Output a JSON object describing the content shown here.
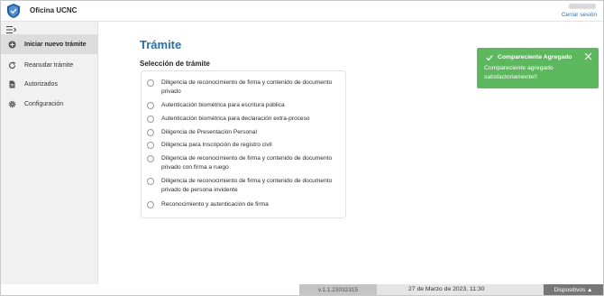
{
  "header": {
    "app_title": "Oficina UCNC",
    "logout_label": "Cerrar sesión",
    "logo_icon": "shield-icon"
  },
  "sidebar": {
    "collapse_icon": "collapse-menu-icon",
    "items": [
      {
        "label": "Iniciar nuevo trámite",
        "icon": "plus-circle-icon",
        "active": true
      },
      {
        "label": "Reanudar trámite",
        "icon": "refresh-icon",
        "active": false
      },
      {
        "label": "Autorizados",
        "icon": "document-icon",
        "active": false
      },
      {
        "label": "Configuración",
        "icon": "gear-icon",
        "active": false
      }
    ]
  },
  "main": {
    "title": "Trámite",
    "section_title": "Selección de trámite",
    "options": [
      "Diligencia de reconocimiento de firma y contenido de documento privado",
      "Autenticación biométrica para escritura pública",
      "Autenticación biométrica para declaración extra-proceso",
      "Diligencia de Presentación Personal",
      "Diligencia para Inscripción de registro civil",
      "Diligencia de reconocimiento de firma y contenido de documento privado con firma a ruego",
      "Diligencia de reconocimiento de firma y contenido de documento privado de persona invidente",
      "Reconocimiento y autenticación de firma"
    ]
  },
  "toast": {
    "title": "Compareciente Agregado",
    "message": "Compareciente agregado satisfactoriamente!!",
    "color": "#5cb85c"
  },
  "footer": {
    "version": "v.1.1.23032315",
    "datetime": "27 de Marzo de 2023, 11:30",
    "devices_label": "Dispositivos ▲"
  },
  "colors": {
    "accent": "#1d6fba",
    "link": "#1a73c9",
    "success": "#5cb85c"
  }
}
